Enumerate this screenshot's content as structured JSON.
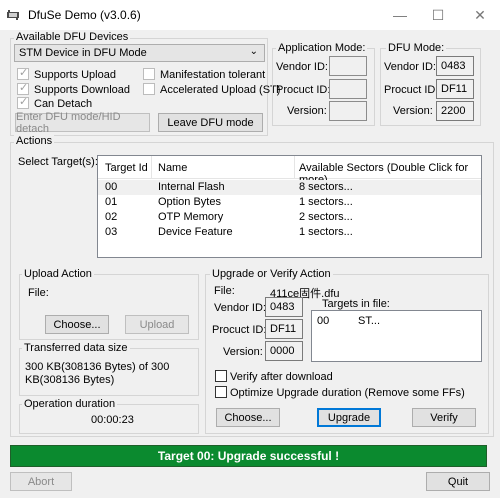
{
  "window": {
    "title": "DfuSe Demo (v3.0.6)"
  },
  "devices": {
    "group_label": "Available DFU Devices",
    "selected": "STM Device in DFU Mode",
    "supports_upload": "Supports Upload",
    "supports_download": "Supports Download",
    "can_detach": "Can Detach",
    "manifestation_tolerant": "Manifestation tolerant",
    "accelerated_upload": "Accelerated Upload (ST)",
    "enter_dfu_button": "Enter DFU mode/HID detach",
    "leave_dfu_button": "Leave DFU mode"
  },
  "app_mode": {
    "label": "Application Mode:",
    "vendor_label": "Vendor ID:",
    "product_label": "Procuct ID:",
    "version_label": "Version:",
    "vendor": "",
    "product": "",
    "version": ""
  },
  "dfu_mode": {
    "label": "DFU Mode:",
    "vendor_label": "Vendor ID:",
    "product_label": "Procuct ID:",
    "version_label": "Version:",
    "vendor": "0483",
    "product": "DF11",
    "version": "2200"
  },
  "actions": {
    "label": "Actions",
    "select_targets": "Select Target(s):",
    "columns": [
      "Target Id",
      "Name",
      "Available Sectors (Double Click for more)"
    ],
    "rows": [
      {
        "id": "00",
        "name": "Internal Flash",
        "sectors": "8 sectors..."
      },
      {
        "id": "01",
        "name": "Option Bytes",
        "sectors": "1 sectors..."
      },
      {
        "id": "02",
        "name": "OTP Memory",
        "sectors": "2 sectors..."
      },
      {
        "id": "03",
        "name": "Device Feature",
        "sectors": "1 sectors..."
      }
    ]
  },
  "upload": {
    "label": "Upload Action",
    "file_label": "File:",
    "choose_button": "Choose...",
    "upload_button": "Upload"
  },
  "transferred": {
    "label": "Transferred data size",
    "value": "300 KB(308136 Bytes) of 300 KB(308136 Bytes)"
  },
  "duration": {
    "label": "Operation duration",
    "value": "00:00:23"
  },
  "upgrade": {
    "label": "Upgrade or Verify Action",
    "file_label": "File:",
    "file_value": "411ce固件.dfu",
    "vendor_label": "Vendor ID:",
    "vendor": "0483",
    "product_label": "Procuct ID:",
    "product": "DF11",
    "version_label": "Version:",
    "version": "0000",
    "targets_label": "Targets in file:",
    "targets": [
      {
        "id": "00",
        "name": "ST..."
      }
    ],
    "verify_after_download": "Verify after download",
    "optimize": "Optimize Upgrade duration (Remove some FFs)",
    "choose_button": "Choose...",
    "upgrade_button": "Upgrade",
    "verify_button": "Verify"
  },
  "status": {
    "message": "Target 00: Upgrade successful !"
  },
  "footer": {
    "abort_button": "Abort",
    "quit_button": "Quit"
  },
  "icons": {
    "app": "dfuse-app-icon",
    "minimize": "minimize-icon",
    "maximize": "maximize-icon",
    "close": "close-icon"
  }
}
